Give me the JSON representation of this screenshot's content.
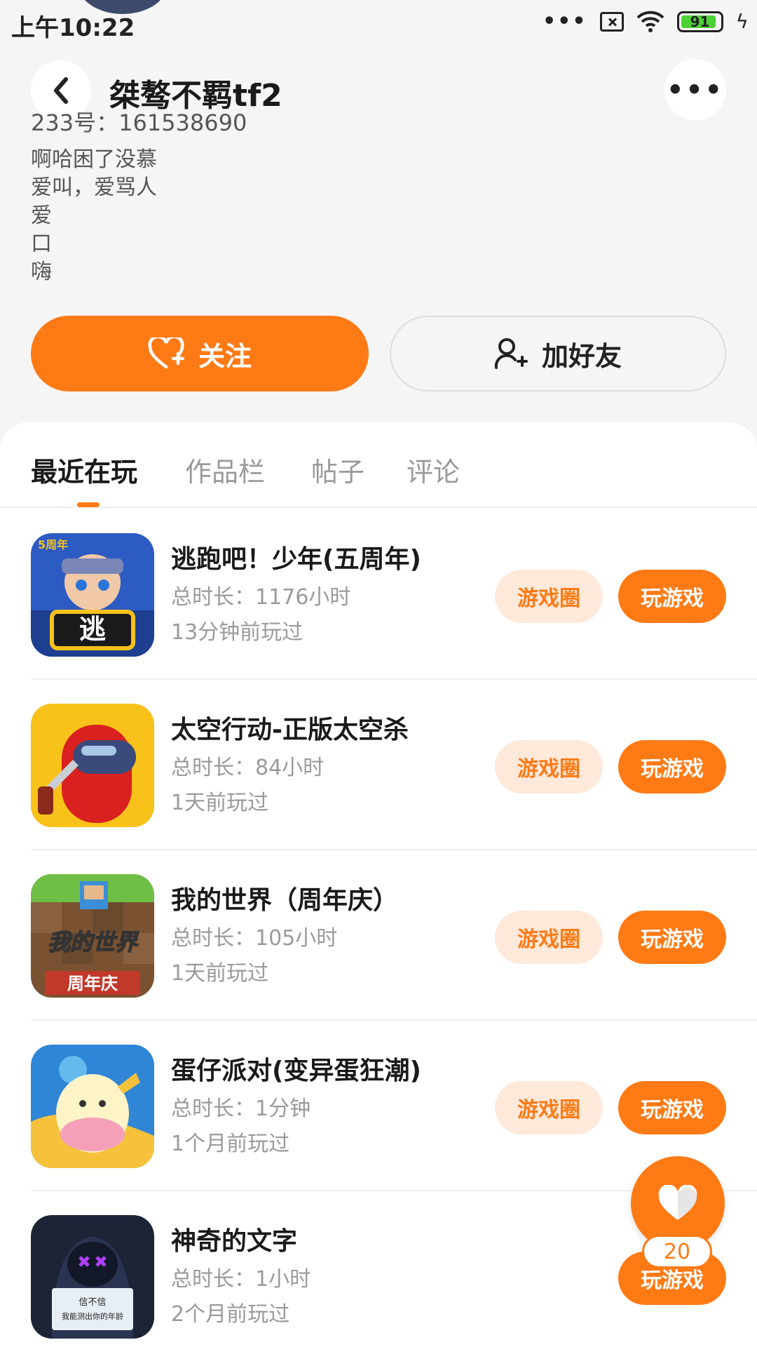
{
  "status_bar": {
    "time": "上午10:22",
    "more_dots": "•••",
    "battery_level": "91",
    "battery_percent": 91
  },
  "profile": {
    "username": "桀骜不羁tf2",
    "user_id": "233号：161538690",
    "bio_lines": [
      "啊哈困了没慕",
      "爱叫，爱骂人",
      "爱",
      "口",
      "嗨"
    ],
    "more_label": "•••"
  },
  "actions": {
    "follow_label": "关注",
    "add_friend_label": "加好友"
  },
  "tabs": [
    {
      "label": "最近在玩",
      "active": true
    },
    {
      "label": "作品栏",
      "active": false
    },
    {
      "label": "帖子",
      "active": false
    },
    {
      "label": "评论",
      "active": false
    }
  ],
  "games": [
    {
      "name": "逃跑吧！少年(五周年)",
      "playtime": "总时长：1176小时",
      "last_played": "13分钟前玩过",
      "circle_label": "游戏圈",
      "play_label": "玩游戏",
      "icon": "escape-game-icon",
      "icon_text": "逃",
      "badge": "5周年"
    },
    {
      "name": "太空行动-正版太空杀",
      "playtime": "总时长：84小时",
      "last_played": "1天前玩过",
      "circle_label": "游戏圈",
      "play_label": "玩游戏",
      "icon": "space-crew-icon"
    },
    {
      "name": "我的世界（周年庆）",
      "playtime": "总时长：105小时",
      "last_played": "1天前玩过",
      "circle_label": "游戏圈",
      "play_label": "玩游戏",
      "icon": "minecraft-icon",
      "icon_text": "我的世界",
      "icon_subtext": "周年庆"
    },
    {
      "name": "蛋仔派对(变异蛋狂潮)",
      "playtime": "总时长：1分钟",
      "last_played": "1个月前玩过",
      "circle_label": "游戏圈",
      "play_label": "玩游戏",
      "icon": "egg-party-icon"
    },
    {
      "name": "神奇的文字",
      "playtime": "总时长：1小时",
      "last_played": "2个月前玩过",
      "play_label": "玩游戏",
      "icon": "magic-words-icon",
      "icon_text_1": "信不信",
      "icon_text_2": "我能测出你的年龄"
    }
  ],
  "floating_like": {
    "count": "20",
    "icon": "heart-icon"
  },
  "colors": {
    "accent": "#fe7a15",
    "accent_light": "#fee9db",
    "background": "#f5f5f5"
  }
}
